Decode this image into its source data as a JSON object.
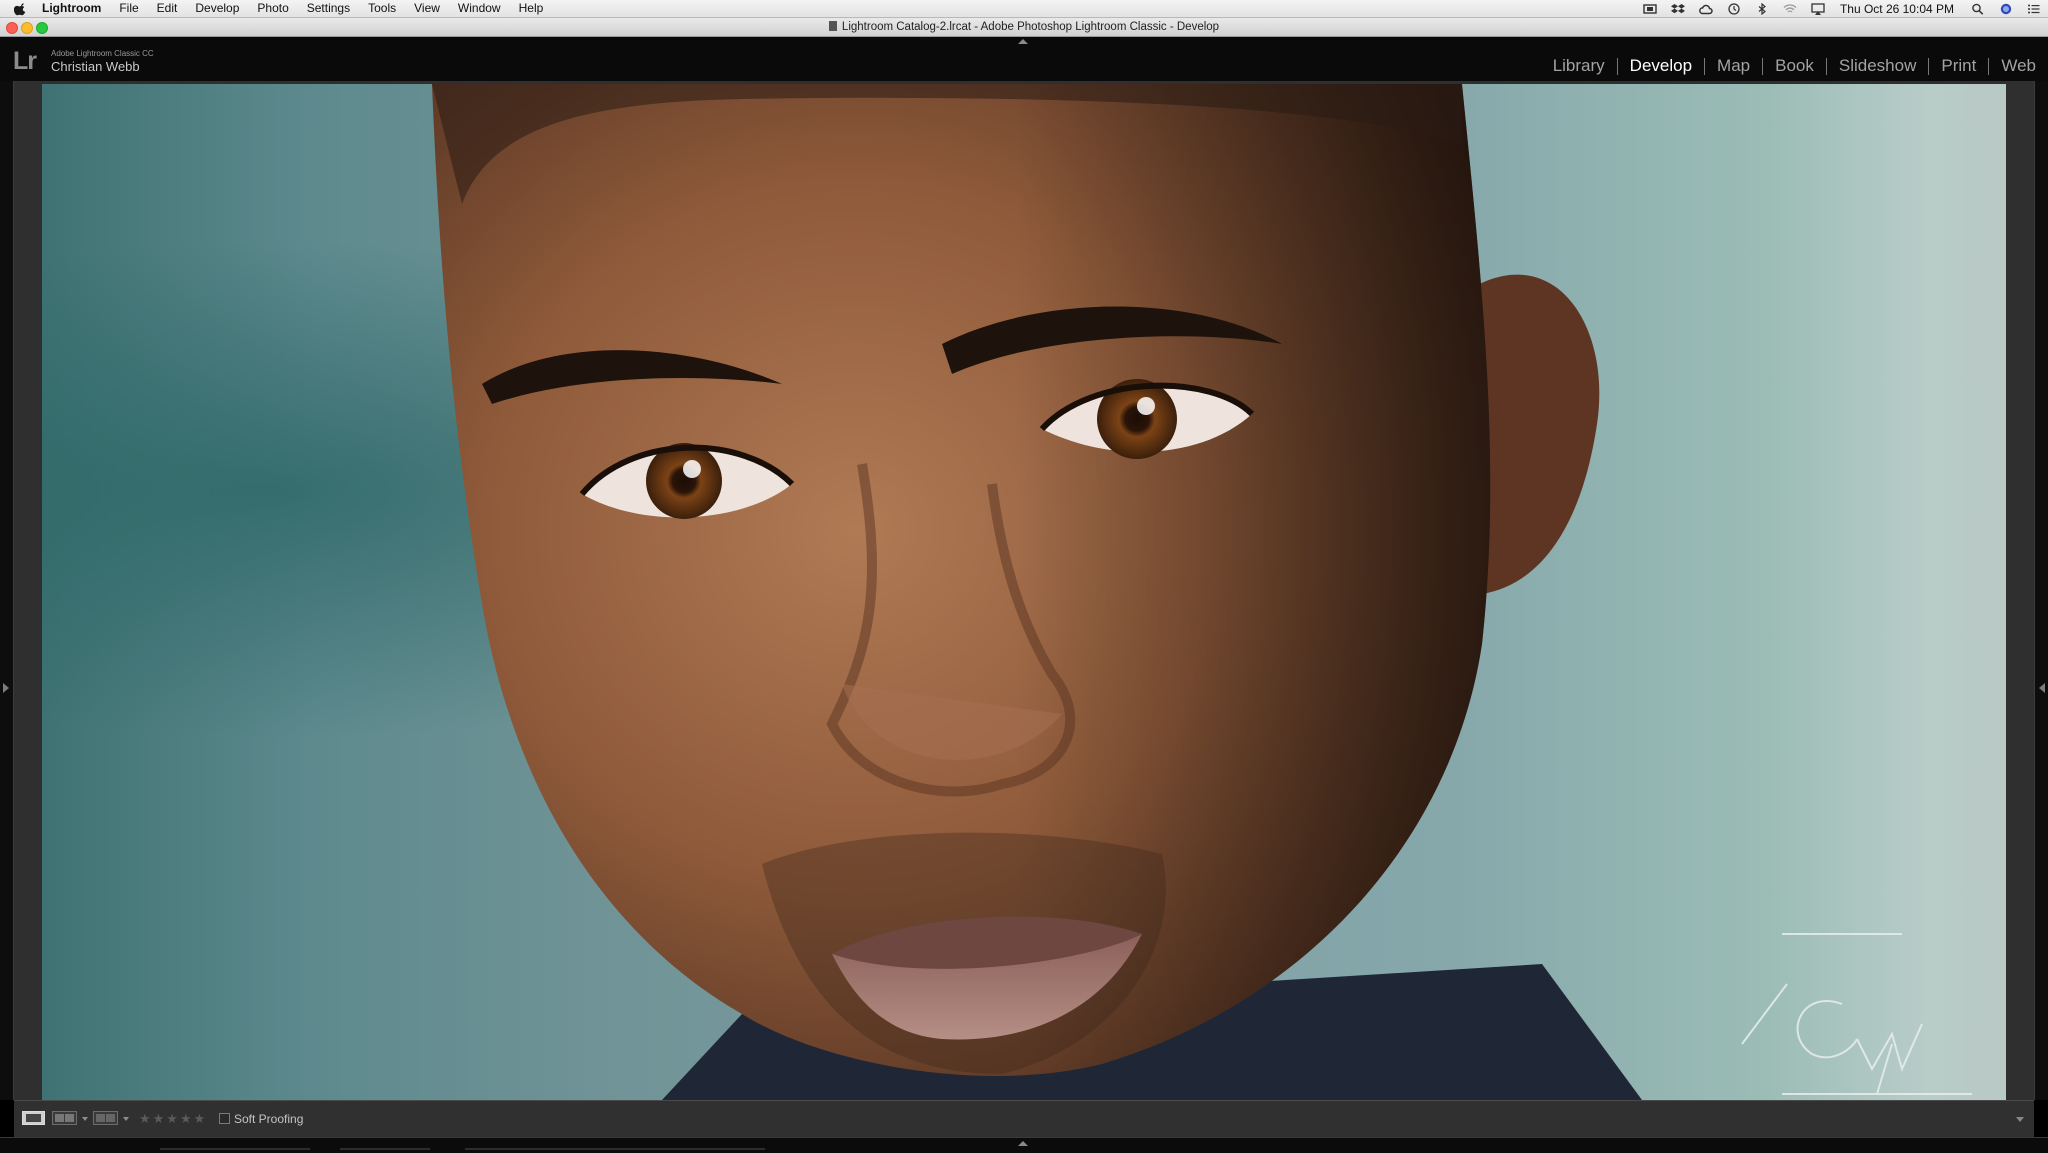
{
  "menubar": {
    "app_name": "Lightroom",
    "menus": [
      "File",
      "Edit",
      "Develop",
      "Photo",
      "Settings",
      "Tools",
      "View",
      "Window",
      "Help"
    ],
    "clock": "Thu Oct 26  10:04 PM",
    "status_icons": [
      "display-icon",
      "dropbox-icon",
      "creative-cloud-icon",
      "time-machine-icon",
      "bluetooth-icon",
      "wifi-icon",
      "airplay-icon",
      "spotlight-search-icon",
      "siri-icon",
      "notification-center-icon"
    ]
  },
  "window": {
    "title": "Lightroom Catalog-2.lrcat - Adobe Photoshop Lightroom Classic - Develop"
  },
  "identity": {
    "logo": "Lr",
    "product": "Adobe Lightroom Classic CC",
    "user": "Christian Webb"
  },
  "modules": {
    "active": "Develop",
    "items": [
      "Library",
      "Develop",
      "Map",
      "Book",
      "Slideshow",
      "Print",
      "Web"
    ]
  },
  "photo": {
    "subject": "Close-up portrait of a man",
    "watermark": "TCW"
  },
  "toolbar": {
    "view_modes": [
      "loupe-view-icon",
      "before-after-view-icon",
      "survey-view-icon"
    ],
    "rating_stars": 0,
    "soft_proofing_label": "Soft Proofing",
    "soft_proofing_checked": false
  },
  "colors": {
    "active_module": "#ffffff",
    "inactive_module": "#a3a3a3",
    "panel_bg": "#0a0a0a",
    "toolbar_bg": "#303030",
    "background_teal": "#6f9396"
  }
}
